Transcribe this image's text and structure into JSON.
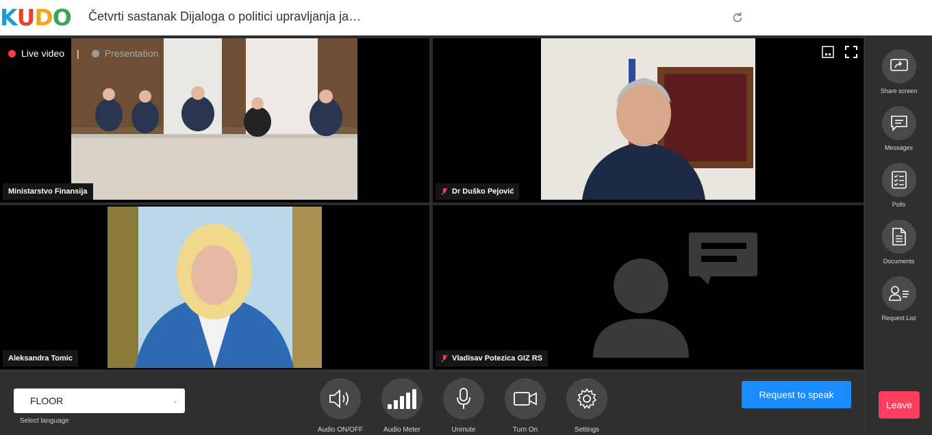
{
  "app": {
    "logo_text": "KUDO",
    "logo_colors": [
      "#1d9bd7",
      "#e8422e",
      "#f2a61c",
      "#35a853"
    ],
    "meeting_title": "Četvrti sastanak Dijaloga o politici upravljanja ja…",
    "refresh_icon": "refresh-icon"
  },
  "view_toggle": {
    "live_label": "Live video",
    "separator": "|",
    "presentation_label": "Presentation",
    "active_color": "#ff3b4e"
  },
  "tiles": [
    {
      "name": "Ministarstvo Finansija",
      "muted": false
    },
    {
      "name": "Dr Duško Pejović",
      "muted": true
    },
    {
      "name": "Aleksandra Tomic",
      "muted": false
    },
    {
      "name": "Vladisav Potezica GIZ RS",
      "muted": true
    }
  ],
  "sidebar": {
    "items": [
      {
        "label": "Share screen",
        "icon": "share-screen-icon"
      },
      {
        "label": "Messages",
        "icon": "messages-icon"
      },
      {
        "label": "Polls",
        "icon": "polls-icon"
      },
      {
        "label": "Documents",
        "icon": "documents-icon"
      },
      {
        "label": "Request List",
        "icon": "request-list-icon"
      }
    ]
  },
  "bottom": {
    "language_value": "FLOOR",
    "language_hint": "Select language",
    "controls": [
      {
        "label": "Audio ON/OFF",
        "icon": "speaker-icon"
      },
      {
        "label": "Audio Meter",
        "icon": "audio-meter-icon"
      },
      {
        "label": "Unmute",
        "icon": "microphone-icon"
      },
      {
        "label": "Turn On",
        "icon": "camera-icon"
      },
      {
        "label": "Settings",
        "icon": "gear-icon"
      }
    ],
    "request_to_speak": "Request to speak",
    "leave": "Leave",
    "accent_color": "#1a8cff",
    "leave_color": "#ff3d5e"
  }
}
